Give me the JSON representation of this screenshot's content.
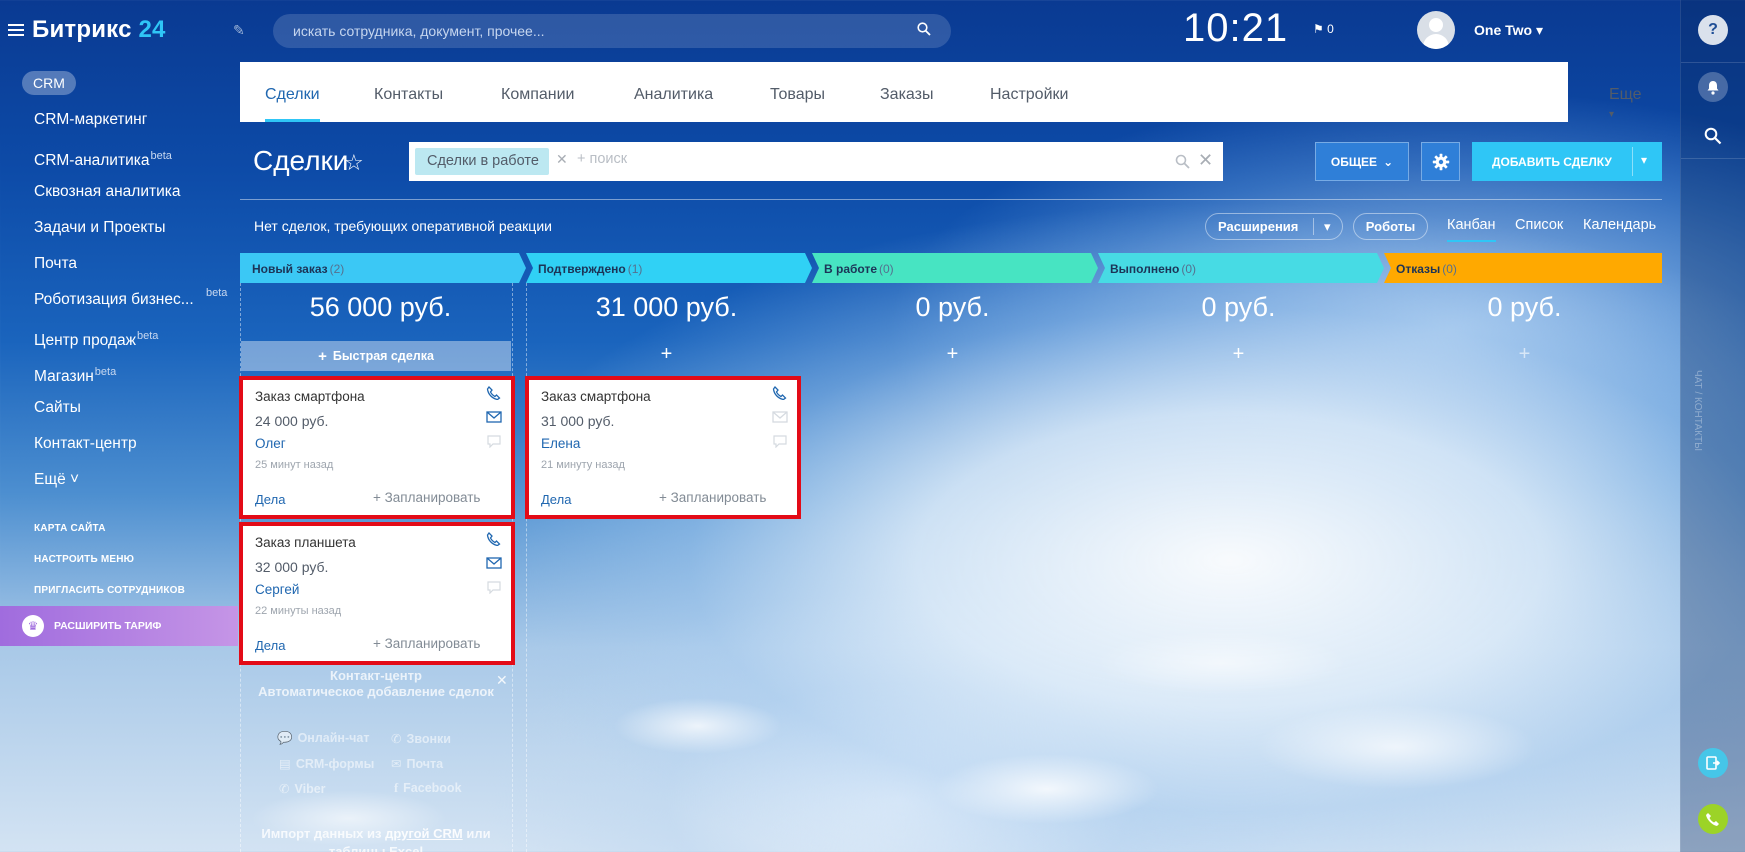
{
  "app": {
    "logo_main": "Битрикс",
    "logo_num": "24"
  },
  "sidebar": {
    "active_section": "CRM",
    "items": [
      {
        "label": "CRM-маркетинг",
        "badge": ""
      },
      {
        "label": "CRM-аналитика",
        "badge": "beta"
      },
      {
        "label": "Сквозная аналитика",
        "badge": ""
      },
      {
        "label": "Задачи и Проекты",
        "badge": ""
      },
      {
        "label": "Почта",
        "badge": ""
      },
      {
        "label": "Роботизация бизнес...",
        "badge": "beta"
      },
      {
        "label": "Центр продаж",
        "badge": "beta"
      },
      {
        "label": "Магазин",
        "badge": "beta"
      },
      {
        "label": "Сайты",
        "badge": ""
      },
      {
        "label": "Контакт-центр",
        "badge": ""
      },
      {
        "label": "Ещё ˅",
        "badge": ""
      }
    ],
    "links": [
      "КАРТА САЙТА",
      "НАСТРОИТЬ МЕНЮ",
      "ПРИГЛАСИТЬ СОТРУДНИКОВ"
    ],
    "tariff": "РАСШИРИТЬ ТАРИФ"
  },
  "header": {
    "search_placeholder": "искать сотрудника, документ, прочее...",
    "clock": "10:21",
    "flag_count": "0",
    "user_name": "One Two"
  },
  "tabs": [
    {
      "label": "Сделки",
      "active": true
    },
    {
      "label": "Контакты"
    },
    {
      "label": "Компании"
    },
    {
      "label": "Аналитика"
    },
    {
      "label": "Товары"
    },
    {
      "label": "Заказы"
    },
    {
      "label": "Настройки"
    },
    {
      "label": "Еще"
    }
  ],
  "page": {
    "title": "Сделки",
    "filter_chip": "Сделки в работе",
    "filter_placeholder": "+ поиск",
    "btn_general": "ОБЩЕЕ",
    "btn_add": "ДОБАВИТЬ СДЕЛКУ",
    "notice": "Нет сделок, требующих оперативной реакции",
    "btn_extensions": "Расширения",
    "btn_robots": "Роботы",
    "views": [
      "Канбан",
      "Список",
      "Календарь"
    ]
  },
  "columns": [
    {
      "title": "Новый заказ",
      "count": "(2)",
      "sum": "56 000 руб.",
      "color": "#3bc8f5"
    },
    {
      "title": "Подтверждено",
      "count": "(1)",
      "sum": "31 000 руб.",
      "color": "#30d1f5"
    },
    {
      "title": "В работе",
      "count": "(0)",
      "sum": "0 руб.",
      "color": "#47e4c2"
    },
    {
      "title": "Выполнено",
      "count": "(0)",
      "sum": "0 руб.",
      "color": "#47dbe4"
    },
    {
      "title": "Отказы",
      "count": "(0)",
      "sum": "0 руб.",
      "color": "#ffa900"
    }
  ],
  "quick_deal": "Быстрая сделка",
  "cards": [
    {
      "title": "Заказ смартфона",
      "price": "24 000 руб.",
      "client": "Олег",
      "time": "25 минут назад",
      "deals": "Дела",
      "plan": "+ Запланировать"
    },
    {
      "title": "Заказ планшета",
      "price": "32 000 руб.",
      "client": "Сергей",
      "time": "22 минуты назад",
      "deals": "Дела",
      "plan": "+ Запланировать"
    },
    {
      "title": "Заказ смартфона",
      "price": "31 000 руб.",
      "client": "Елена",
      "time": "21 минуту назад",
      "deals": "Дела",
      "plan": "+ Запланировать"
    }
  ],
  "promo": {
    "title": "Контакт-центр",
    "subtitle": "Автоматическое добавление сделок",
    "items": [
      "Онлайн-чат",
      "Звонки",
      "CRM-формы",
      "Почта",
      "Viber",
      "Facebook"
    ],
    "import_prefix": "Импорт данных из ",
    "import_link": "другой CRM",
    "import_suffix": " или",
    "import_line2": "таблицы Excel"
  },
  "rail": {
    "vertical_text": "ЧАТ / КОНТАКТЫ"
  }
}
